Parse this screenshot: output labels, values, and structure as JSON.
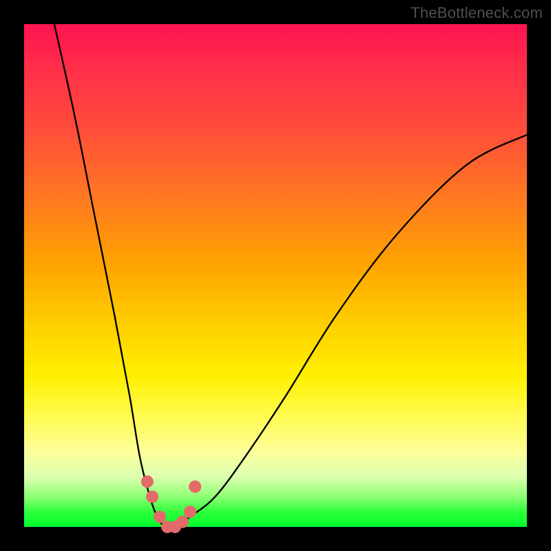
{
  "watermark": "TheBottleneck.com",
  "chart_data": {
    "type": "line",
    "title": "",
    "xlabel": "",
    "ylabel": "",
    "xlim": [
      0,
      100
    ],
    "ylim": [
      0,
      100
    ],
    "series": [
      {
        "name": "bottleneck-curve",
        "x": [
          6,
          10,
          14,
          18,
          21,
          23,
          25,
          26.5,
          28,
          30,
          33,
          38,
          44,
          52,
          62,
          74,
          88,
          100
        ],
        "values": [
          100,
          82,
          62,
          42,
          26,
          14,
          6,
          2,
          0,
          0,
          2,
          6,
          14,
          26,
          42,
          58,
          72,
          78
        ]
      }
    ],
    "markers": {
      "name": "highlight-dots",
      "color": "#e46a6a",
      "x": [
        24.5,
        25.5,
        27,
        28.5,
        30,
        31.5,
        33,
        34
      ],
      "values": [
        9,
        6,
        2,
        0,
        0,
        1,
        3,
        8
      ]
    }
  },
  "colors": {
    "curve": "#000000",
    "marker": "#e46a6a",
    "frame": "#000000"
  }
}
